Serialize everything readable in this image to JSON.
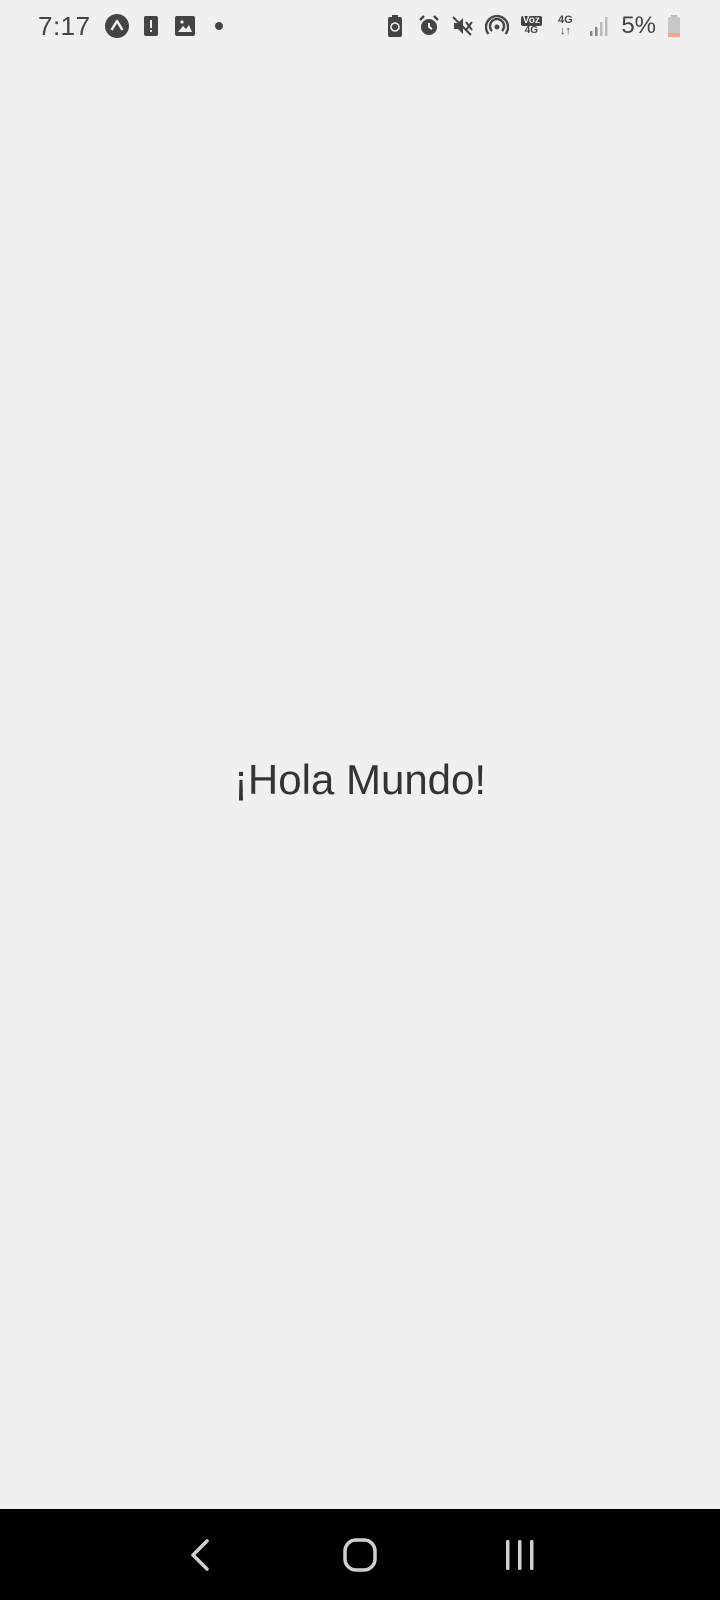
{
  "status_bar": {
    "time": "7:17",
    "battery_percent": "5%",
    "network_label": "4G",
    "volte_top": "Voz",
    "volte_bottom": "4G",
    "icons": [
      "expo-icon",
      "alert-icon",
      "image-icon",
      "notification-dot",
      "battery-saver-icon",
      "alarm-icon",
      "mute-icon",
      "hotspot-icon",
      "volte-icon",
      "network-4g-icon",
      "signal-icon",
      "battery-icon"
    ],
    "battery_color": "#f4a38c"
  },
  "main": {
    "greeting": "¡Hola Mundo!"
  },
  "nav_bar": {
    "buttons": [
      "back",
      "home",
      "recents"
    ]
  }
}
